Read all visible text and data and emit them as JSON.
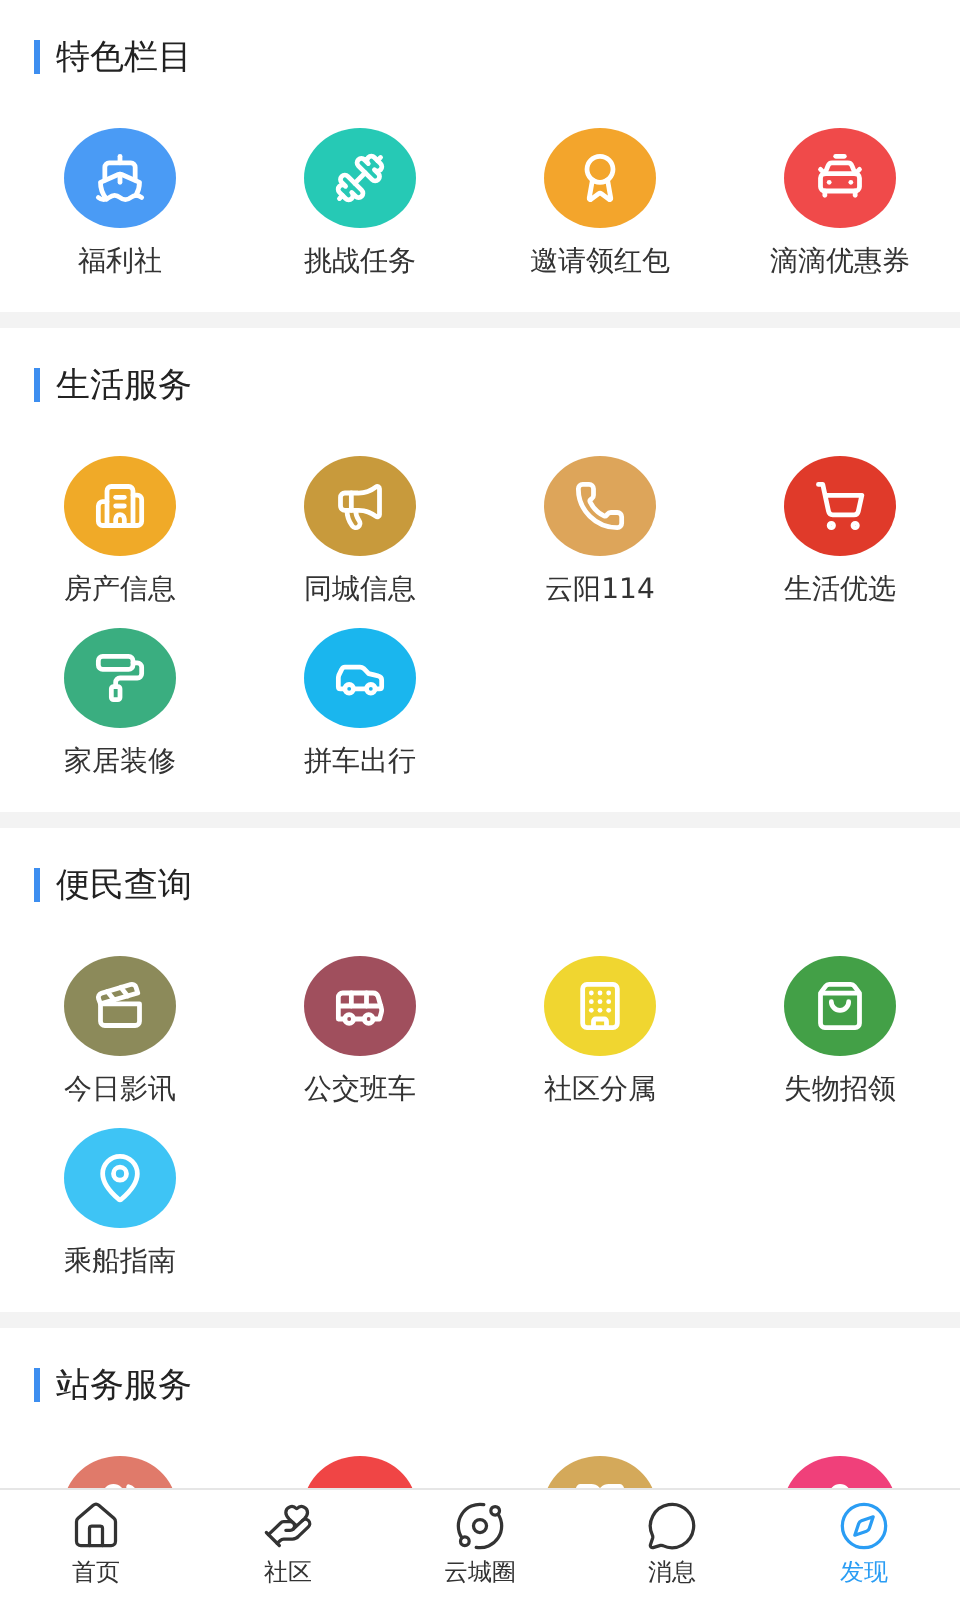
{
  "sections": [
    {
      "title": "特色栏目",
      "items": [
        {
          "label": "福利社",
          "color": "#4a9bf5"
        },
        {
          "label": "挑战任务",
          "color": "#26c9b5"
        },
        {
          "label": "邀请领红包",
          "color": "#f3a52c"
        },
        {
          "label": "滴滴优惠券",
          "color": "#f04a4a"
        }
      ]
    },
    {
      "title": "生活服务",
      "items": [
        {
          "label": "房产信息",
          "color": "#f0aa28"
        },
        {
          "label": "同城信息",
          "color": "#c89a3c"
        },
        {
          "label": "云阳114",
          "color": "#dda55a"
        },
        {
          "label": "生活优选",
          "color": "#e03a2a"
        },
        {
          "label": "家居装修",
          "color": "#3aae80"
        },
        {
          "label": "拼车出行",
          "color": "#1ab6ee"
        }
      ]
    },
    {
      "title": "便民查询",
      "items": [
        {
          "label": "今日影讯",
          "color": "#8c8a5a"
        },
        {
          "label": "公交班车",
          "color": "#a04f5d"
        },
        {
          "label": "社区分属",
          "color": "#f0d630"
        },
        {
          "label": "失物招领",
          "color": "#43a047"
        },
        {
          "label": "乘船指南",
          "color": "#3ec4f5"
        }
      ]
    },
    {
      "title": "站务服务",
      "items": [
        {
          "color": "#e07a6a"
        },
        {
          "color": "#f04545"
        },
        {
          "color": "#d4a95a"
        },
        {
          "color": "#f0407a"
        }
      ]
    }
  ],
  "tabs": [
    {
      "label": "首页",
      "selected": false
    },
    {
      "label": "社区",
      "selected": false
    },
    {
      "label": "云城圈",
      "selected": false
    },
    {
      "label": "消息",
      "selected": false
    },
    {
      "label": "发现",
      "selected": true
    }
  ]
}
